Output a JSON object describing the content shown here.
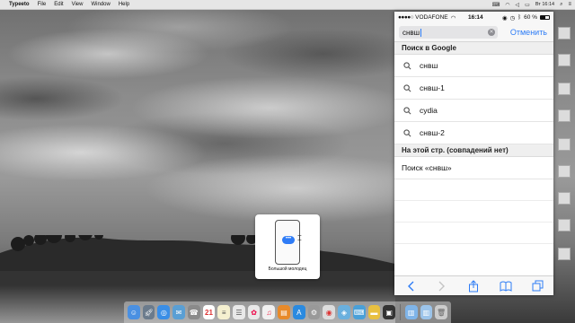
{
  "menubar": {
    "app_name": "Typeeto",
    "items": [
      "File",
      "Edit",
      "View",
      "Window",
      "Help"
    ],
    "clock": "Вт 16:14"
  },
  "phone": {
    "status": {
      "carrier": "VODAFONE",
      "time": "16:14",
      "battery": "60 %"
    },
    "search": {
      "query": "снвш",
      "cancel_label": "Отменить"
    },
    "google_section": {
      "header": "Поиск в Google",
      "suggestions": [
        "снвш",
        "снвш-1",
        "cydia",
        "снвш-2"
      ]
    },
    "page_section": {
      "header": "На этой стр. (совпадений нет)",
      "find_label": "Поиск «снвш»"
    }
  },
  "popup": {
    "caption": "Большой молодец",
    "bubble": "•••"
  },
  "dock": {
    "calendar_day": "21"
  },
  "colors": {
    "accent": "#2d7cf6",
    "menubar_bg": "#e6e6e6",
    "section_bg": "#efefef"
  }
}
